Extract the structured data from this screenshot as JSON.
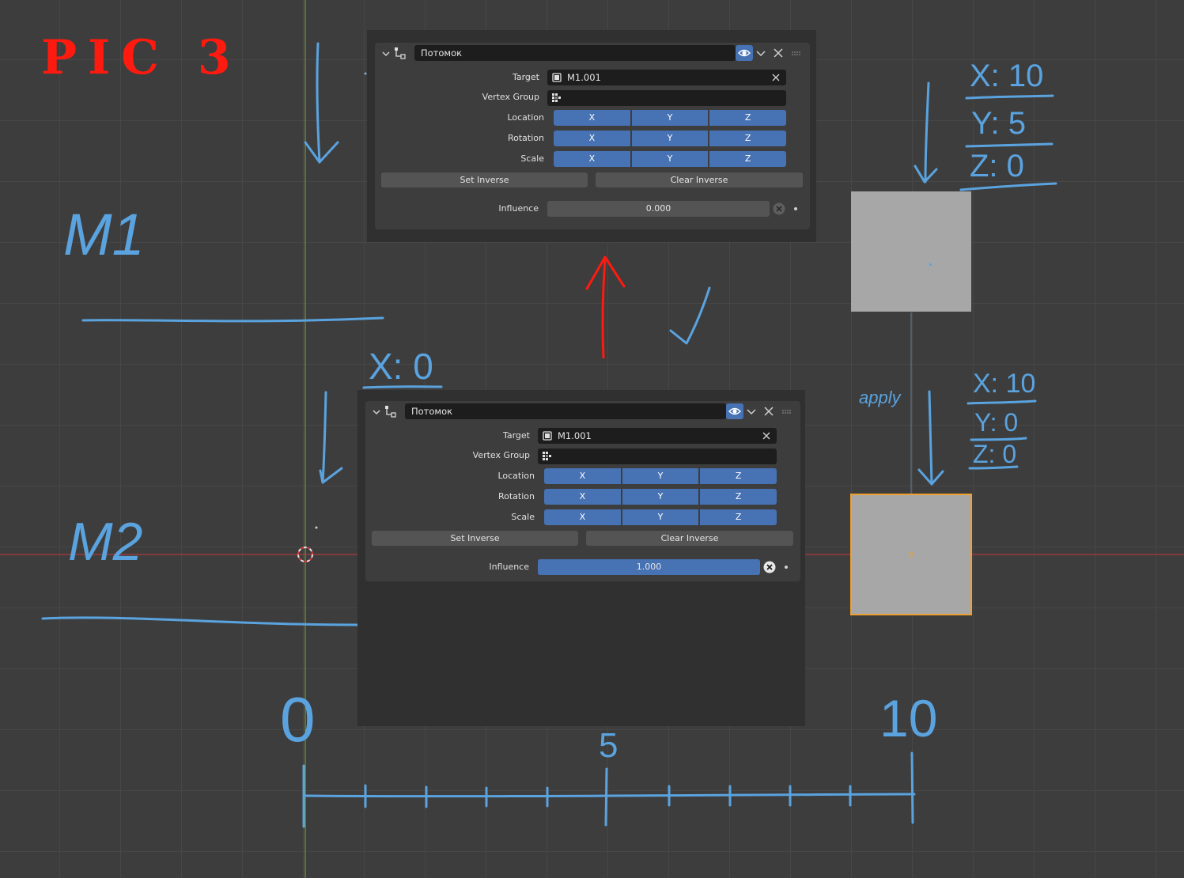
{
  "annotations": {
    "title": "PIC 3",
    "m1": "M1",
    "m2": "M2",
    "x0": "X: 0",
    "top_coords": [
      "X: 10",
      "Y: 5",
      "Z: 0"
    ],
    "bottom_coords": [
      "X: 10",
      "Y: 0",
      "Z: 0"
    ],
    "apply": "apply",
    "axis_labels": [
      "0",
      "5",
      "10"
    ]
  },
  "panels": [
    {
      "constraint_name": "Потомок",
      "target_label": "Target",
      "target_value": "M1.001",
      "vertex_group_label": "Vertex Group",
      "vertex_group_value": "",
      "location_label": "Location",
      "rotation_label": "Rotation",
      "scale_label": "Scale",
      "axes": [
        "X",
        "Y",
        "Z"
      ],
      "set_inverse": "Set Inverse",
      "clear_inverse": "Clear Inverse",
      "influence_label": "Influence",
      "influence_value": "0.000",
      "influence_fraction": 0
    },
    {
      "constraint_name": "Потомок",
      "target_label": "Target",
      "target_value": "M1.001",
      "vertex_group_label": "Vertex Group",
      "vertex_group_value": "",
      "location_label": "Location",
      "rotation_label": "Rotation",
      "scale_label": "Scale",
      "axes": [
        "X",
        "Y",
        "Z"
      ],
      "set_inverse": "Set Inverse",
      "clear_inverse": "Clear Inverse",
      "influence_label": "Influence",
      "influence_value": "1.000",
      "influence_fraction": 1
    }
  ],
  "colors": {
    "accent": "#4772b3",
    "annotation_blue": "#5aa3df",
    "annotation_red": "#ff1a10",
    "selection_outline": "#f0a030",
    "axis_x": "#c8383c",
    "axis_y": "#7aa63a"
  },
  "icons": [
    "chevron-down-icon",
    "constraint-child-of-icon",
    "eye-icon",
    "close-icon",
    "grip-icon",
    "object-icon",
    "vertex-group-icon",
    "clear-icon"
  ]
}
